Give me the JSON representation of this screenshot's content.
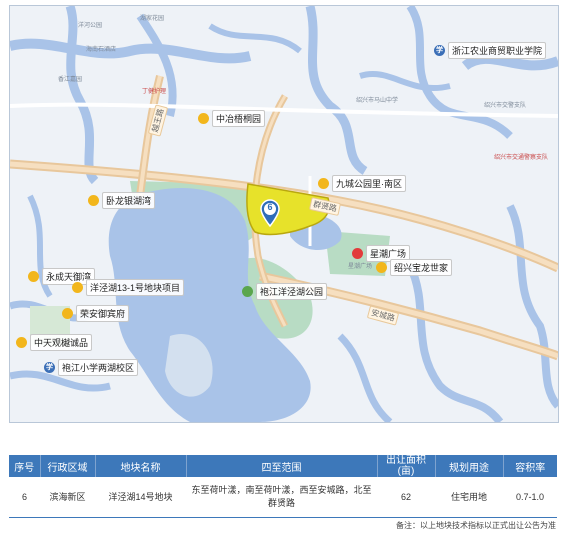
{
  "map": {
    "plot_number": "6",
    "big_labels": {
      "zhongye": "中冶梧桐园",
      "jiucheng": "九城公园里·南区",
      "wolong": "卧龙银湖湾",
      "yongcheng": "永成天御湾",
      "yangjing13": "洋泾湖13-1号地块项目",
      "rongan": "荣安御宾府",
      "zhongtian": "中天观樾诚品",
      "paojiang_school": "袍江小学两湖校区",
      "paojiang_park": "袍江洋泾湖公园",
      "xingchao": "星潮广场",
      "shaoxing_baolong": "绍兴宝龙世家",
      "agri_college": "浙江农业商贸职业学院"
    },
    "road_labels": {
      "qunxian_lu": "群贤路",
      "anxing_lu": "安城路",
      "second_road": "越王路"
    },
    "tiny_labels": {
      "t1": "洋河公园",
      "t2": "湖家花园",
      "t3": "海南石酒店",
      "t4": "香江嘉园",
      "t5": "丁健护理",
      "t6": "绍兴市马山中学",
      "t7": "绍兴市交警支队",
      "t8": "绍兴市交通警察支队",
      "t9": "星潮广场"
    }
  },
  "table": {
    "headers": {
      "seq": "序号",
      "district": "行政区域",
      "plot_name": "地块名称",
      "bounds": "四至范围",
      "area": "出让面积(亩)",
      "use": "规划用途",
      "far": "容积率"
    },
    "row": {
      "seq": "6",
      "district": "滨海新区",
      "plot_name": "洋泾湖14号地块",
      "bounds": "东至荷叶漾，南至荷叶漾，西至安城路，北至群贤路",
      "area": "62",
      "use": "住宅用地",
      "far": "0.7-1.0"
    }
  },
  "note": "备注：以上地块技术指标以正式出让公告为准",
  "colors": {
    "water": "#a9c3e8",
    "land": "#eef2f7",
    "green": "#b8dcc4",
    "road": "#e8c79c",
    "plot": "#e7e22a",
    "header": "#3d78ba"
  }
}
